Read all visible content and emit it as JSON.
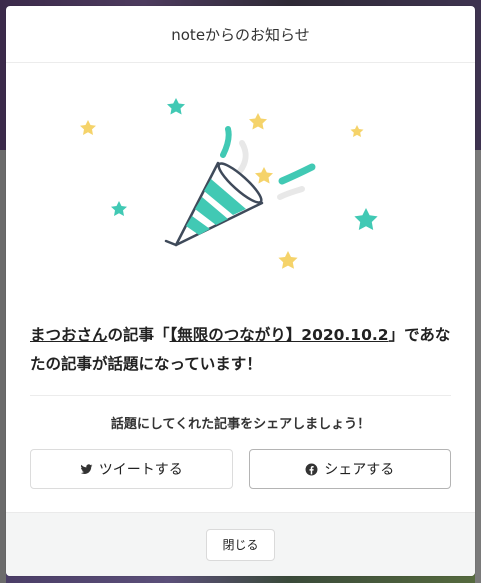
{
  "modal": {
    "title": "noteからのお知らせ",
    "message": {
      "author": "まつおさん",
      "part1": "の記事「",
      "article": "【無限のつながり】2020.10.2",
      "part2": "」であなたの記事が話題になっています！"
    },
    "share_prompt": "話題にしてくれた記事をシェアしましょう！",
    "tweet_label": "ツイートする",
    "share_label": "シェアする",
    "close_label": "閉じる"
  },
  "colors": {
    "accent_teal": "#41c9b4",
    "star_yellow": "#f5d36a",
    "star_teal": "#41c9b4",
    "outline": "#3f4a5a"
  }
}
